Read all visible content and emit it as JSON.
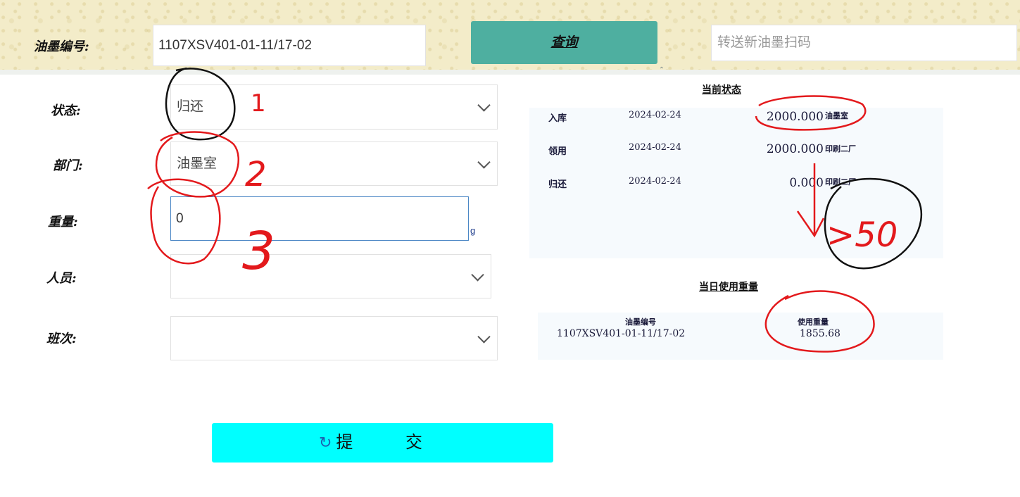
{
  "header": {
    "ink_code_label": "油墨编号:",
    "ink_code_value": "1107XSV401-01-11/17-02",
    "query_label": "查询",
    "scan_placeholder": "转送新油墨扫码"
  },
  "form": {
    "status": {
      "label": "状态:",
      "value": "归还"
    },
    "department": {
      "label": "部门:",
      "value": "油墨室"
    },
    "weight": {
      "label": "重量:",
      "value": "0",
      "unit": "g"
    },
    "person": {
      "label": "人员:",
      "value": ""
    },
    "shift": {
      "label": "班次:",
      "value": ""
    },
    "submit_label": "提 交"
  },
  "current_status": {
    "title": "当前状态",
    "rows": [
      {
        "action": "入库",
        "date": "2024-02-24",
        "weight": "2000.000",
        "dept": "油墨室"
      },
      {
        "action": "领用",
        "date": "2024-02-24",
        "weight": "2000.000",
        "dept": "印刷二厂"
      },
      {
        "action": "归还",
        "date": "2024-02-24",
        "weight": "0.000",
        "dept": "印刷二厂"
      }
    ]
  },
  "daily_usage": {
    "title": "当日使用重量",
    "col_code": "油墨编号",
    "col_weight": "使用重量",
    "code": "1107XSV401-01-11/17-02",
    "weight": "1855.68"
  },
  "annotations": {
    "num1": "1",
    "num2": "2",
    "num3": "3",
    "gt50": ">50",
    "red_color": "#e3191c",
    "black_color": "#111111"
  }
}
